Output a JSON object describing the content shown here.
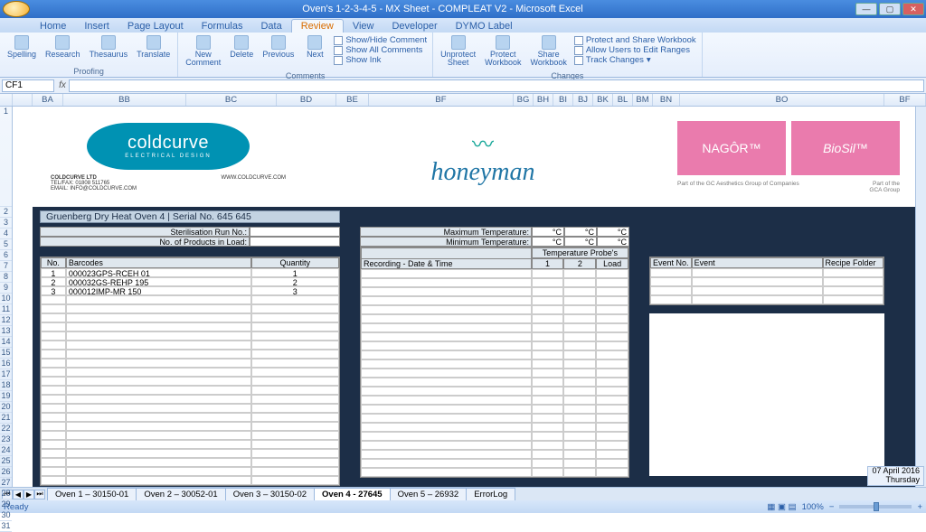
{
  "window": {
    "title": "Oven's 1-2-3-4-5 - MX Sheet - COMPLEAT V2 - Microsoft Excel"
  },
  "tabs": {
    "items": [
      "Home",
      "Insert",
      "Page Layout",
      "Formulas",
      "Data",
      "Review",
      "View",
      "Developer",
      "DYMO Label"
    ],
    "active": "Review"
  },
  "ribbon": {
    "proofing": {
      "spelling": "Spelling",
      "research": "Research",
      "thesaurus": "Thesaurus",
      "translate": "Translate",
      "label": "Proofing"
    },
    "comments": {
      "new": "New\nComment",
      "delete": "Delete",
      "previous": "Previous",
      "next": "Next",
      "showhide": "Show/Hide Comment",
      "showall": "Show All Comments",
      "showink": "Show Ink",
      "label": "Comments"
    },
    "changes": {
      "unprotect": "Unprotect\nSheet",
      "protectwb": "Protect\nWorkbook",
      "share": "Share\nWorkbook",
      "protectshare": "Protect and Share Workbook",
      "allow": "Allow Users to Edit Ranges",
      "track": "Track Changes",
      "label": "Changes"
    }
  },
  "namebox": "CF1",
  "columns": {
    "BA": "BA",
    "BB": "BB",
    "BC": "BC",
    "BD": "BD",
    "BE": "BE",
    "BF": "BF",
    "BG": "BG",
    "BH": "BH",
    "BI": "BI",
    "BJ": "BJ",
    "BK": "BK",
    "BL": "BL",
    "BM": "BM",
    "BN": "BN",
    "BO": "BO",
    "BF_right": "BF"
  },
  "logos": {
    "coldcurve": "coldcurve",
    "coldcurve_sub": "ELECTRICAL DESIGN",
    "company": "COLDCURVE LTD",
    "telfax": "TEL/FAX: 01808 511765",
    "email": "EMAIL: INFO@COLDCURVE.COM",
    "web": "WWW.COLDCURVE.COM",
    "honeyman": "honeyman",
    "nagor": "NAGÔR™",
    "biosil": "BioSil™",
    "gca_left": "Part of the GC Aesthetics Group of Companies",
    "gca_right": "Part of the\nGCA Group"
  },
  "sheet": {
    "oven_title": "Gruenberg Dry Heat Oven 4  |  Serial No. 645 645",
    "sterilisation": "Sterilisation Run No.:",
    "products": "No. of Products in Load:",
    "maxtemp": "Maximum Temperature:",
    "mintemp": "Minimum Temperature:",
    "degc": "°C",
    "tempprobes": "Temperature Probe's",
    "recording": "Recording - Date & Time",
    "col1": "1",
    "col2": "2",
    "colload": "Load",
    "eventno": "Event No.",
    "event": "Event",
    "recipe": "Recipe Folder",
    "no": "No.",
    "barcodes": "Barcodes",
    "quantity": "Quantity",
    "rows": [
      {
        "n": "1",
        "bc": "000023GPS-RCEH 01",
        "q": "1"
      },
      {
        "n": "2",
        "bc": "000032GS-REHP 195",
        "q": "2"
      },
      {
        "n": "3",
        "bc": "000012IMP-MR 150",
        "q": "3"
      }
    ]
  },
  "sheettabs": {
    "items": [
      "Oven 1 – 30150-01",
      "Oven 2 – 30052-01",
      "Oven 3 – 30150-02",
      "Oven 4 - 27645",
      "Oven 5 – 26932",
      "ErrorLog"
    ],
    "active": "Oven 4 - 27645"
  },
  "status": {
    "ready": "Ready",
    "zoom": "100%",
    "date": "07 April 2016",
    "day": "Thursday"
  }
}
